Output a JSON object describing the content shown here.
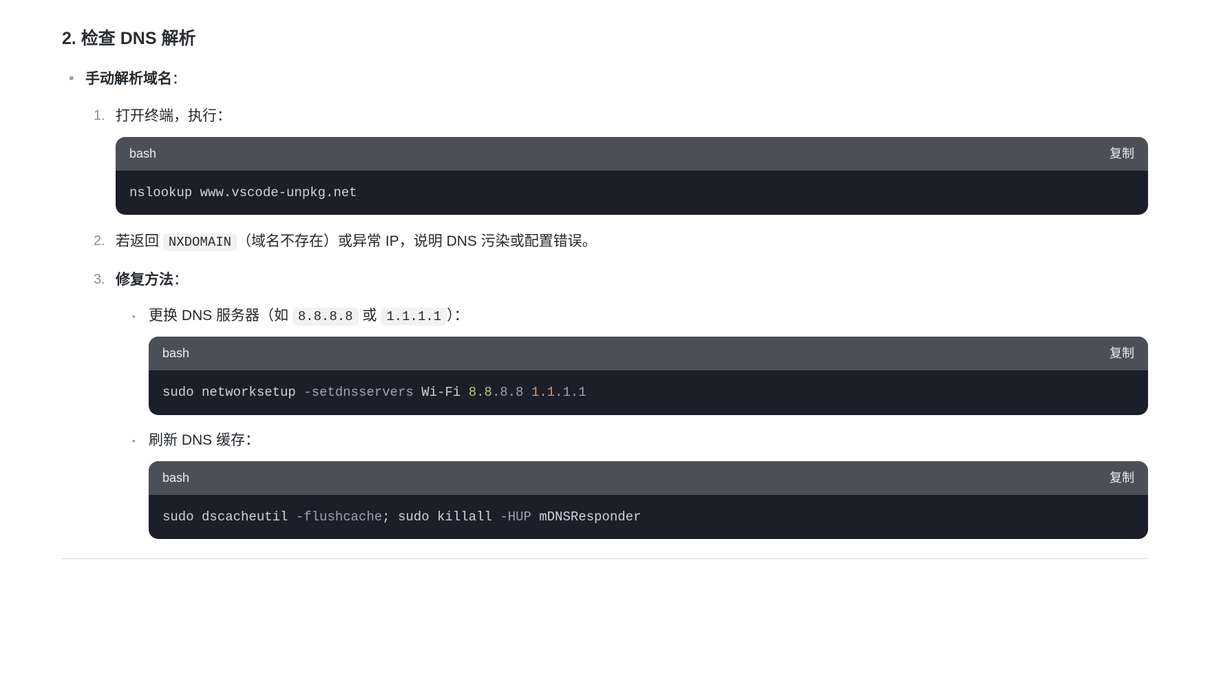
{
  "heading": "2. 检查 DNS 解析",
  "bullet_label": "手动解析域名",
  "bullet_colon": "：",
  "step1_text": "打开终端，执行：",
  "code1": {
    "lang": "bash",
    "copy": "复制",
    "line": "nslookup www.vscode-unpkg.net"
  },
  "step2": {
    "pre": "若返回 ",
    "code": "NXDOMAIN",
    "post": "（域名不存在）或异常 IP，说明 DNS 污染或配置错误。"
  },
  "step3_label": "修复方法",
  "step3_colon": "：",
  "sub1": {
    "pre": "更换 DNS 服务器（如 ",
    "c1": "8.8.8.8",
    "mid": " 或 ",
    "c2": "1.1.1.1",
    "post": "）："
  },
  "code2": {
    "lang": "bash",
    "copy": "复制",
    "tokens": {
      "sudo": "sudo",
      "cmd": "networksetup",
      "flag": "-setdnsservers",
      "wifi": "Wi-Fi",
      "ip1a": "8.8",
      "ip1b": ".8.8",
      "ip2a": "1.1",
      "ip2b": ".1.1"
    }
  },
  "sub2_text": "刷新 DNS 缓存：",
  "code3": {
    "lang": "bash",
    "copy": "复制",
    "tokens": {
      "sudo1": "sudo",
      "cmd1": "dscacheutil",
      "flag1": "-flushcache",
      "semi": ";",
      "sudo2": "sudo",
      "cmd2": "killall",
      "flag2": "-HUP",
      "target": "mDNSResponder"
    }
  }
}
